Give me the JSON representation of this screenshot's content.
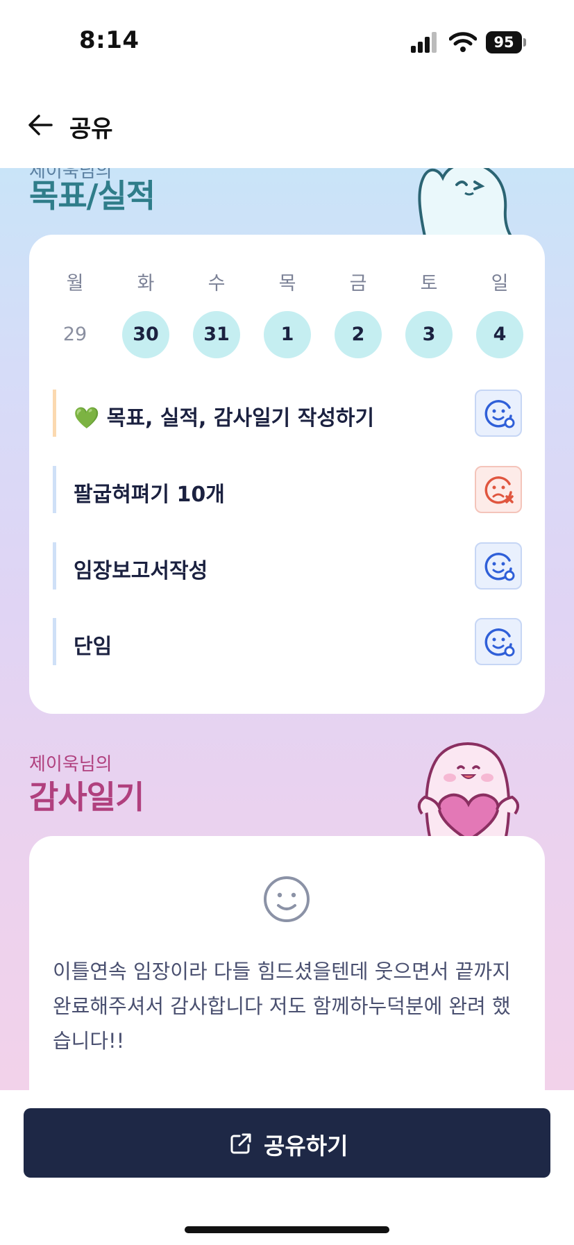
{
  "status_bar": {
    "time": "8:14",
    "battery": "95",
    "signal_icon": "cellular-signal-icon",
    "wifi_icon": "wifi-icon"
  },
  "header": {
    "title": "공유",
    "back_icon": "arrow-left-icon"
  },
  "goals_section": {
    "subtitle": "제이욱님의",
    "title": "목표/실적",
    "day_labels": [
      "월",
      "화",
      "수",
      "목",
      "금",
      "토",
      "일"
    ],
    "dates": [
      "29",
      "30",
      "31",
      "1",
      "2",
      "3",
      "4"
    ],
    "items": [
      {
        "text": "💚 목표, 실적, 감사일기 작성하기",
        "status": "done"
      },
      {
        "text": "팔굽혀펴기 10개",
        "status": "failed"
      },
      {
        "text": "임장보고서작성",
        "status": "done"
      },
      {
        "text": "단임",
        "status": "done"
      }
    ]
  },
  "diary_section": {
    "subtitle": "제이욱님의",
    "title": "감사일기",
    "face_icon": "smile-face-icon",
    "text": "이틀연속 임장이라 다들 힘드셨을텐데 웃으면서 끝까지 완료해주셔서 감사합니다 저도 함께하누덕분에 완려 했습니다!!"
  },
  "share_button": {
    "label": "공유하기",
    "icon": "external-share-icon"
  },
  "colors": {
    "accent_teal": "#2f7d8a",
    "accent_pink": "#b0407e",
    "button_navy": "#1e2846",
    "date_chip": "#c5eef1"
  }
}
